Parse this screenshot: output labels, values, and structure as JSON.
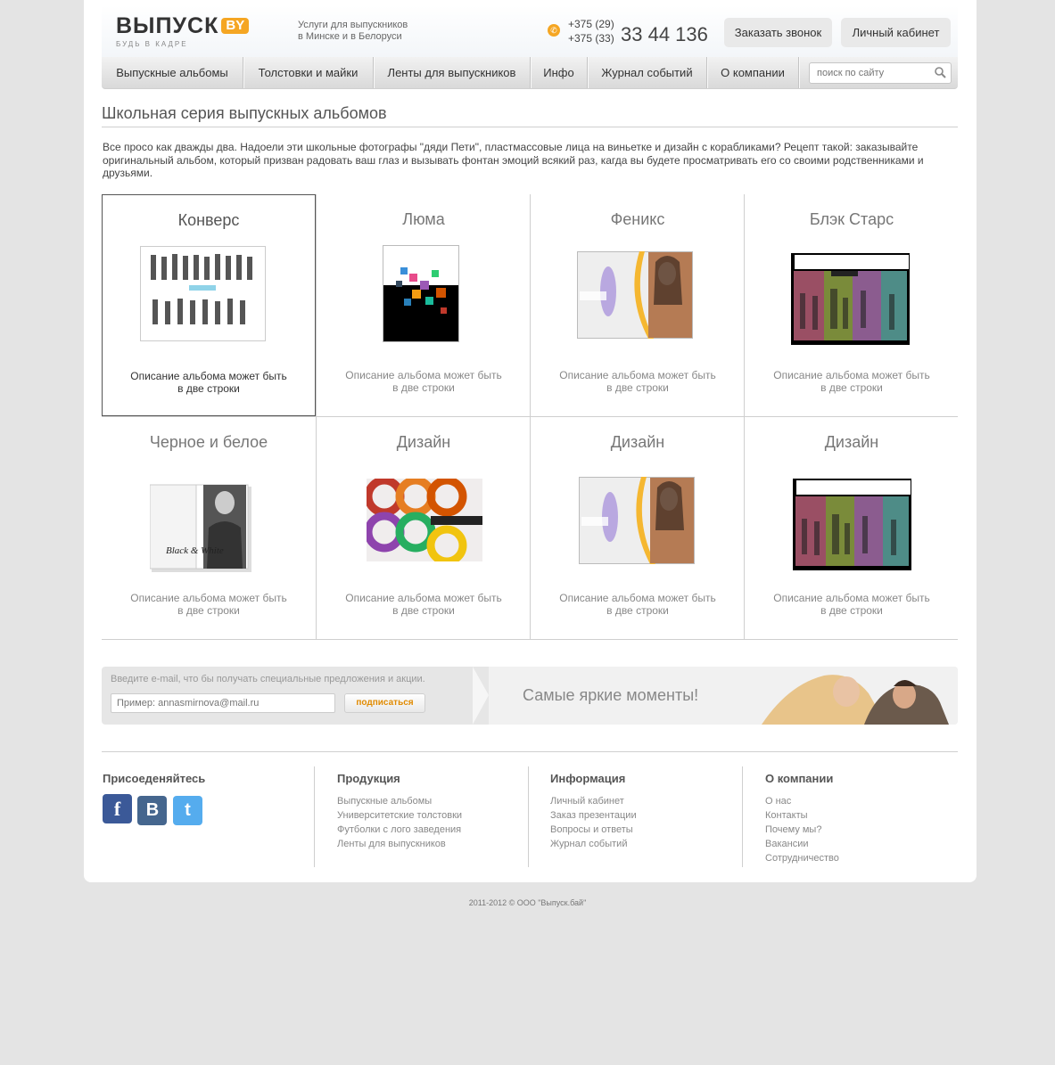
{
  "header": {
    "logo_text": "ВЫПУСК",
    "logo_badge": "BY",
    "logo_tagline": "БУДЬ В КАДРЕ",
    "services_line1": "Услуги для выпускников",
    "services_line2": "в Минске и в Белоруси",
    "phone_code1": "+375 (29)",
    "phone_code2": "+375 (33)",
    "phone_number": "33 44 136",
    "callback_button": "Заказать звонок",
    "cabinet_button": "Личный кабинет"
  },
  "nav": {
    "items": [
      "Выпускные альбомы",
      "Толстовки и майки",
      "Ленты для выпускников",
      "Инфо",
      "Журнал событий",
      "О компании"
    ],
    "search_placeholder": "поиск по сайту"
  },
  "main": {
    "title": "Школьная серия выпускных альбомов",
    "intro": "Все просо как дважды два. Надоели эти школьные фотографы \"дяди Пети\", пластмассовые лица на виньетке и дизайн с корабликами? Рецепт такой: заказывайте оригинальный альбом, который призван радовать ваш глаз и вызывать фонтан эмоций всякий раз, кагда вы будете просматривать его со своими родственниками и друзьями.",
    "albums": [
      {
        "title": "Конверс",
        "desc1": "Описание альбома может быть",
        "desc2": "в две строки",
        "active": true
      },
      {
        "title": "Люма",
        "desc1": "Описание альбома может быть",
        "desc2": "в две строки"
      },
      {
        "title": "Феникс",
        "desc1": "Описание альбома может быть",
        "desc2": "в две строки"
      },
      {
        "title": "Блэк Старс",
        "desc1": "Описание альбома может быть",
        "desc2": "в две строки"
      },
      {
        "title": "Черное и белое",
        "desc1": "Описание альбома может быть",
        "desc2": "в две строки",
        "cover_text": "Black & White"
      },
      {
        "title": "Дизайн",
        "desc1": "Описание альбома может быть",
        "desc2": "в две строки"
      },
      {
        "title": "Дизайн",
        "desc1": "Описание альбома может быть",
        "desc2": "в две строки"
      },
      {
        "title": "Дизайн",
        "desc1": "Описание альбома может быть",
        "desc2": "в две строки"
      }
    ]
  },
  "subscribe": {
    "label": "Введите e-mail, что бы получать специальные предложения и акции.",
    "input_placeholder": "Пример: annasmirnova@mail.ru",
    "button": "подписаться",
    "slogan": "Самые яркие моменты!"
  },
  "footer": {
    "social_title": "Присоеденяйтесь",
    "social_icons": [
      "facebook-icon",
      "vkontakte-icon",
      "twitter-icon"
    ],
    "columns": [
      {
        "title": "Продукция",
        "links": [
          "Выпускные альбомы",
          "Университетские толстовки",
          "Футболки с лого заведения",
          "Ленты для выпускников"
        ]
      },
      {
        "title": "Информация",
        "links": [
          "Личный кабинет",
          "Заказ презентации",
          "Вопросы и ответы",
          "Журнал событий"
        ]
      },
      {
        "title": "О компании",
        "links": [
          "О нас",
          "Контакты",
          "Почему мы?",
          "Вакансии",
          "Сотрудничество"
        ]
      }
    ],
    "copyright": "2011-2012  ©  ООО \"Выпуск.бай\""
  },
  "colors": {
    "accent": "#f5a623",
    "background": "#e4e4e4",
    "facebook": "#3b5998",
    "vkontakte": "#45668e",
    "twitter": "#55acee"
  }
}
